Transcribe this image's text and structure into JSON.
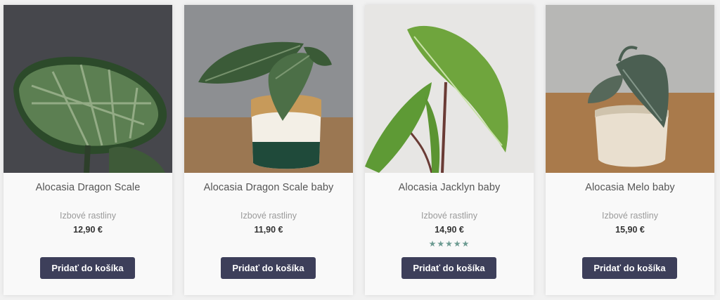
{
  "products": [
    {
      "title": "Alocasia Dragon Scale",
      "category": "Izbové rastliny",
      "price": "12,90 €",
      "button": "Pridať do košíka",
      "rating": null
    },
    {
      "title": "Alocasia Dragon Scale baby",
      "category": "Izbové rastliny",
      "price": "11,90 €",
      "button": "Pridať do košíka",
      "rating": null
    },
    {
      "title": "Alocasia Jacklyn baby",
      "category": "Izbové rastliny",
      "price": "14,90 €",
      "button": "Pridať do košíka",
      "rating": 5,
      "stars": "★★★★★"
    },
    {
      "title": "Alocasia Melo baby",
      "category": "Izbové rastliny",
      "price": "15,90 €",
      "button": "Pridať do košíka",
      "rating": null
    }
  ],
  "colors": {
    "button_bg": "#3d3f5a",
    "button_text": "#ffffff",
    "star": "#6d9b92",
    "card_bg": "#f9f9f9"
  },
  "icons": [
    "product-photo",
    "star-rating"
  ]
}
